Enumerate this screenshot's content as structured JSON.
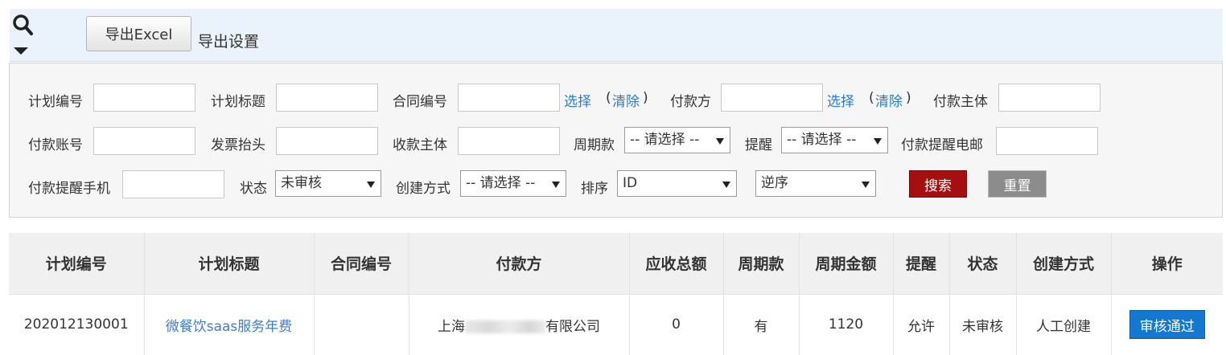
{
  "toolbar": {
    "export_excel_label": "导出Excel",
    "export_settings_label": "导出设置"
  },
  "filters": {
    "plan_no_label": "计划编号",
    "plan_title_label": "计划标题",
    "contract_no_label": "合同编号",
    "payer_label": "付款方",
    "pay_entity_label": "付款主体",
    "pay_account_label": "付款账号",
    "invoice_title_label": "发票抬头",
    "receive_entity_label": "收款主体",
    "periodic_label": "周期款",
    "remind_label": "提醒",
    "remind_email_label": "付款提醒电邮",
    "remind_phone_label": "付款提醒手机",
    "status_label": "状态",
    "create_method_label": "创建方式",
    "sort_label": "排序",
    "select_link": "选择",
    "clear_link": "清除",
    "paren_open": "(",
    "paren_close": ")",
    "periodic_value": "-- 请选择 --",
    "remind_value": "-- 请选择 --",
    "status_value": "未审核",
    "create_method_value": "-- 请选择 --",
    "sort_field_value": "ID",
    "sort_order_value": "逆序",
    "search_button": "搜索",
    "reset_button": "重置"
  },
  "table": {
    "headers": [
      "计划编号",
      "计划标题",
      "合同编号",
      "付款方",
      "应收总额",
      "周期款",
      "周期金额",
      "提醒",
      "状态",
      "创建方式",
      "操作"
    ],
    "rows": [
      {
        "plan_no": "202012130001",
        "plan_title": "微餐饮saas服务年费",
        "contract_no": "",
        "payer_prefix": "上海",
        "payer_suffix": "有限公司",
        "total_receivable": "0",
        "periodic": "有",
        "period_amount": "1120",
        "remind": "允许",
        "status": "未审核",
        "create_method": "人工创建",
        "action": "审核通过"
      }
    ]
  },
  "colors": {
    "toolbar_bg": "#eaf2fb",
    "link": "#2a7ccd",
    "search_button": "#a50f0f",
    "reset_button": "#8c8c8c",
    "approve_button": "#1478d0"
  },
  "icons": [
    "search-icon",
    "caret-down-icon"
  ]
}
